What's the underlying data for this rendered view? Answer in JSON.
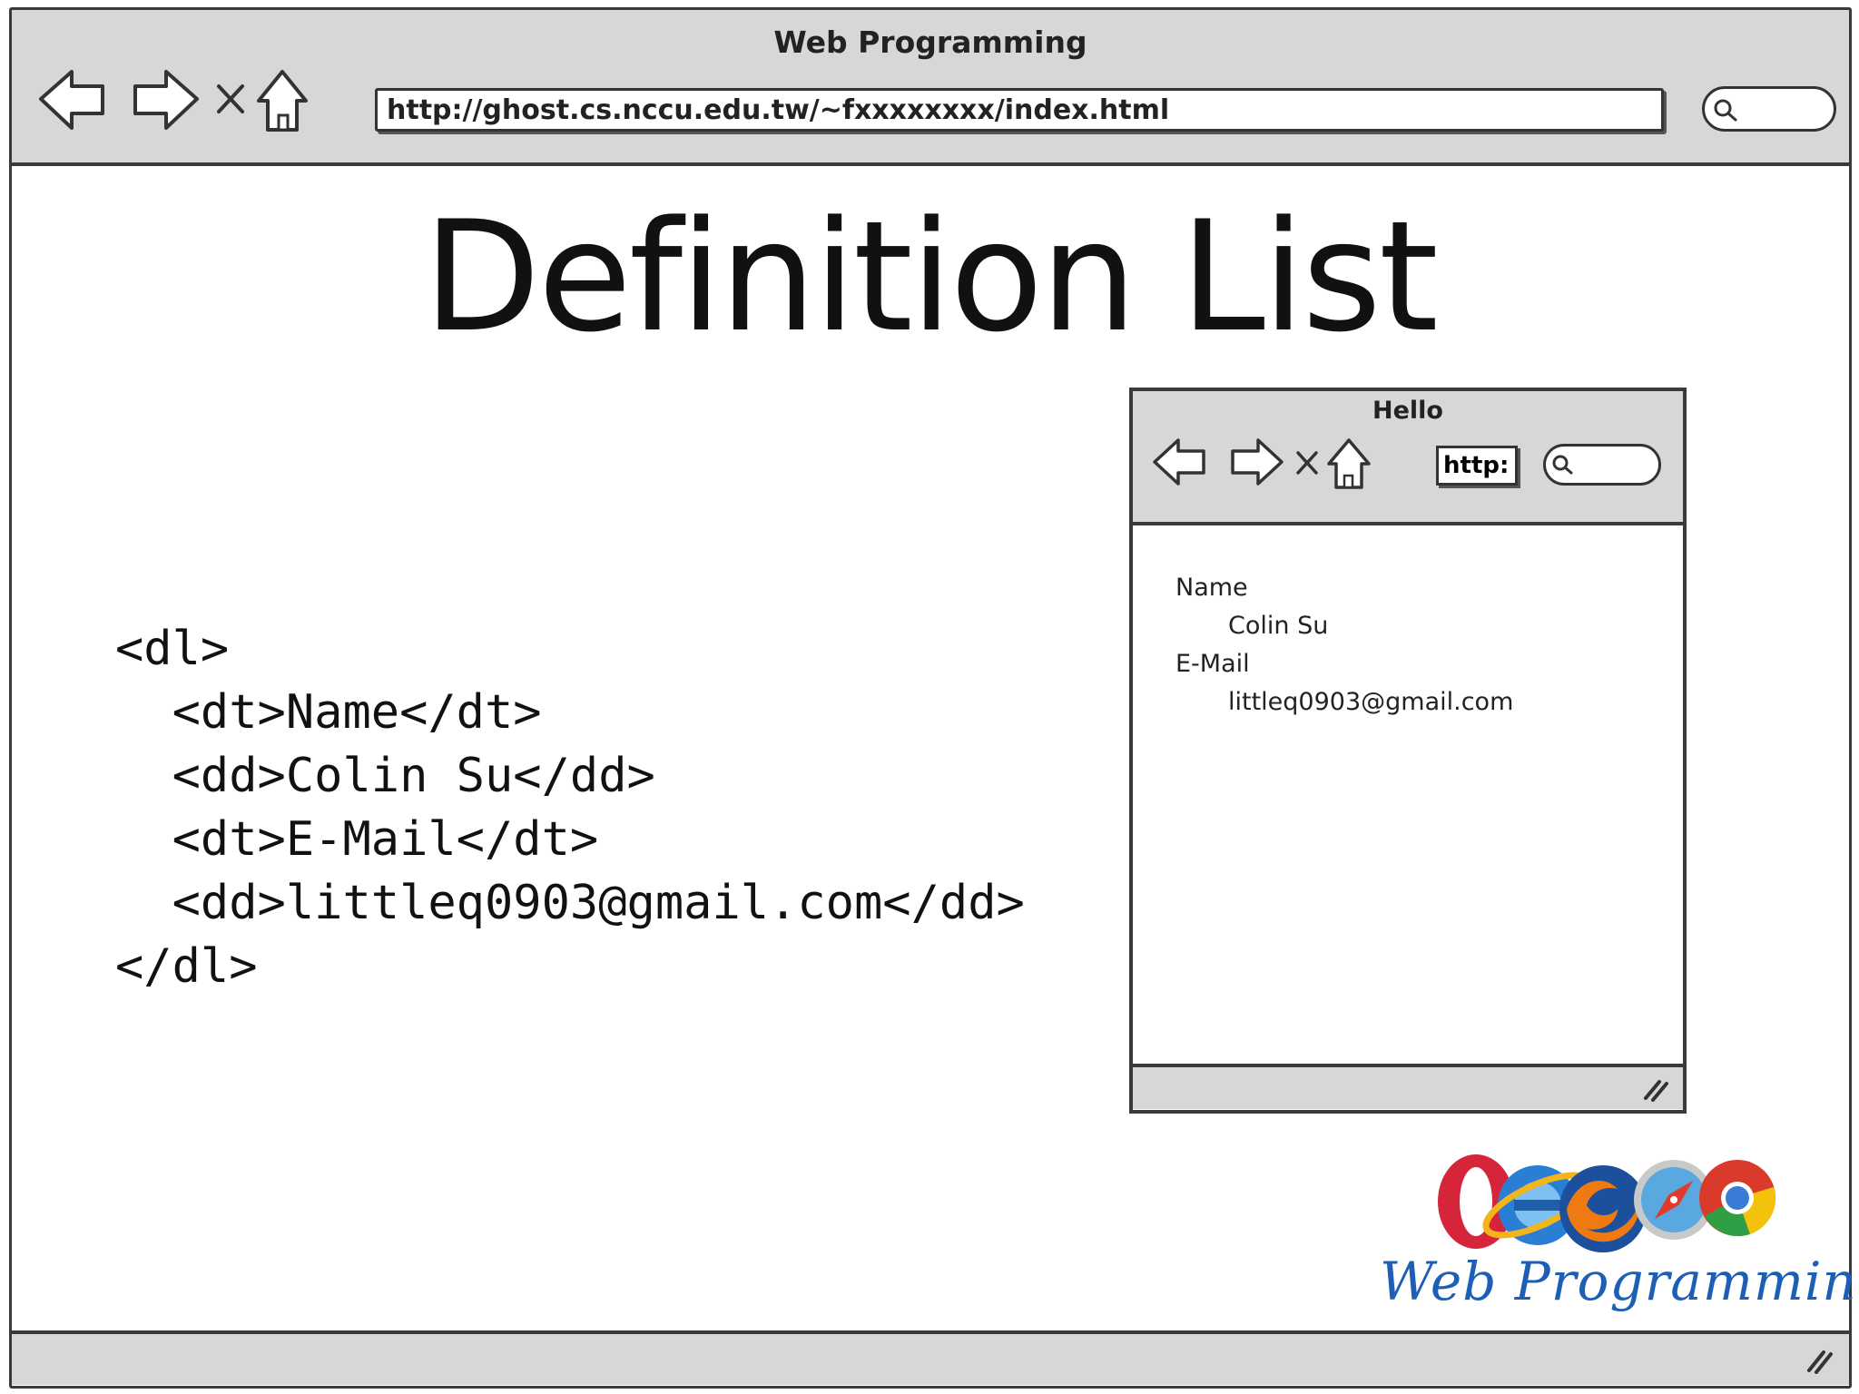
{
  "outer_browser": {
    "title": "Web Programming",
    "url": "http://ghost.cs.nccu.edu.tw/~fxxxxxxxx/index.html",
    "icons": [
      "back-arrow-icon",
      "forward-arrow-icon",
      "stop-icon",
      "home-icon",
      "search-icon",
      "resize-grip-icon"
    ]
  },
  "slide": {
    "title": "Definition List",
    "code": "<dl>\n  <dt>Name</dt>\n  <dd>Colin Su</dd>\n  <dt>E-Mail</dt>\n  <dd>littleq0903@gmail.com</dd>\n</dl>"
  },
  "inner_browser": {
    "title": "Hello",
    "url": "http:",
    "list": [
      {
        "term": "Name",
        "definition": "Colin Su"
      },
      {
        "term": "E-Mail",
        "definition": "littleq0903@gmail.com"
      }
    ]
  },
  "branding": {
    "text": "Web Programming",
    "colors": {
      "opera": "#d6243b",
      "ie": "#2a7fd4",
      "firefox": "#f07a12",
      "safari": "#5aa8e0",
      "chrome": "#d93a2b",
      "text": "#1c5fb5"
    }
  }
}
